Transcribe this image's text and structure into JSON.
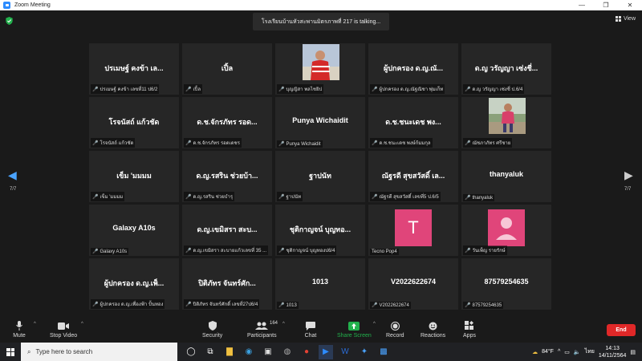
{
  "window": {
    "title": "Zoom Meeting"
  },
  "meeting": {
    "talking_text": "โรงเรียนบ้านหัวสะพานมิตรภาพที่ 217 is  talking...",
    "view_label": "View",
    "page_left": "7/7",
    "page_right": "7/7"
  },
  "tiles": [
    {
      "name": "ปรเมษฐ์ คงข้า เล...",
      "label": "ปรเมษฐ์ คงข้า เลขที่11 ป6/2"
    },
    {
      "name": "เปิ้ล",
      "label": "เปิ้ล"
    },
    {
      "name": "",
      "label": "บุญญิสา พลไชยิป"
    },
    {
      "name": "ผู้ปกครอง ด.ญ.ณั...",
      "label": "ผู้ปกครอง ด.ญ.ณัฐณิชา พุ่มเก็ท"
    },
    {
      "name": "ด.ญ วรัญญา เซ่งชี่...",
      "label": "ด.ญ วรัญญา เซ่งชี่ ป.6/4"
    },
    {
      "name": "โรจนัสถ์ แก้วชัด",
      "label": "โรจนัสถ์ แก้วชัด"
    },
    {
      "name": "ด.ช.จักรภัทร รอด...",
      "label": "ด.ช.จักรภัทร รอดเดชร"
    },
    {
      "name": "Punya Wichaidit",
      "label": "Punya Wichaidit"
    },
    {
      "name": "ด.ช.ชนะเดช  พง...",
      "label": "ด.ช.ชนะเดช  พงษ์ก้มมกุล"
    },
    {
      "name": "",
      "label": "ณัชภาภัทร ศรีชาย"
    },
    {
      "name": "เข็ม 'มมมม",
      "label": "เข็ม 'มมมม"
    },
    {
      "name": "ด.ญ.รสริน ช่วยบ้า...",
      "label": "ด.ญ.รสริน ช่วยบำรุ"
    },
    {
      "name": "ฐาปนัท",
      "label": "ฐาปนัท"
    },
    {
      "name": "ณัฐรดี สุขสวัสดิ์ เล...",
      "label": "ณัฐรดี สุขสวัสดิ์ เลขที่5 ป.6/5"
    },
    {
      "name": "thanyaluk",
      "label": "thanyaluk"
    },
    {
      "name": "Galaxy A10s",
      "label": "Galaxy A10s"
    },
    {
      "name": "ด.ญ.เขมิสรา สะบ...",
      "label": "ด.ญ.เขมิสรา สะบายแก้วเลขที่ 35 ..."
    },
    {
      "name": "ชุติกาญจน์ บุญทอ...",
      "label": "ชุติกาญจน์ บุญทองป6/4"
    },
    {
      "name": "",
      "label": "Tecno Pop4",
      "avatar_letter": "T"
    },
    {
      "name": "",
      "label": "วันเพ็ญ รายรักษ์"
    },
    {
      "name": "ผู้ปกครอง ด.ญ.เพ็...",
      "label": "ผู้ปกครอง ด.ญ.เพื่องฟ้า ปั้นทอง"
    },
    {
      "name": "ปิติภัทร จันทร์ศัก...",
      "label": "ปิติภัทร จันทร์ศักดิ์ เลขที่27ป6/4"
    },
    {
      "name": "1013",
      "label": "1013"
    },
    {
      "name": "V2022622674",
      "label": "V2022622674"
    },
    {
      "name": "87579254635",
      "label": "87579254635"
    }
  ],
  "toolbar": {
    "mute": "Mute",
    "stop_video": "Stop Video",
    "security": "Security",
    "participants": "Participants",
    "participants_count": "164",
    "chat": "Chat",
    "share_screen": "Share Screen",
    "record": "Record",
    "reactions": "Reactions",
    "apps": "Apps",
    "end": "End"
  },
  "taskbar": {
    "search_placeholder": "Type here to search",
    "weather": "84°F",
    "language": "ไทย",
    "time": "14:13",
    "date": "14/11/2564"
  },
  "colors": {
    "accent": "#2d8cff",
    "end": "#e02828",
    "share": "#22b14c",
    "avatar": "#e0457a"
  }
}
